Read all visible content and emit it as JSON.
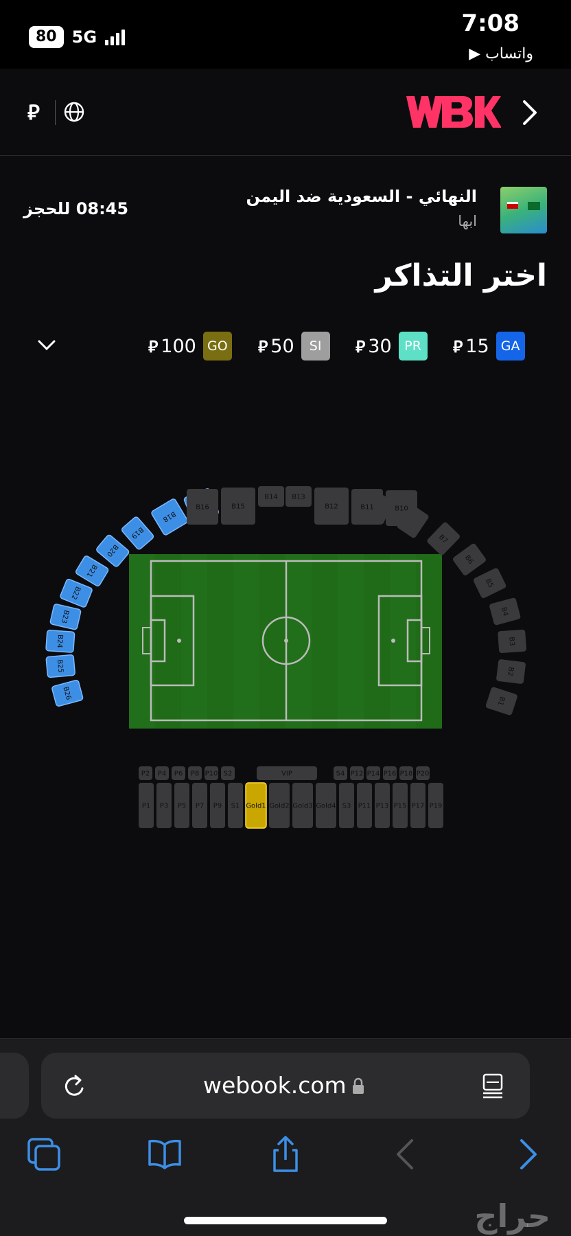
{
  "status_bar": {
    "battery": "80",
    "network": "5G",
    "time": "7:08",
    "back_app": "واتساب ▶"
  },
  "header": {
    "currency_symbol": "⃁",
    "logo_text": "WBK",
    "back_icon": "chevron-right-icon",
    "language_icon": "globe-icon"
  },
  "event": {
    "title": "النهائي - السعودية ضد اليمن",
    "city": "ابها",
    "timer_label": "08:45 للحجز"
  },
  "page_heading": "اختر التذاكر",
  "price_tiers": [
    {
      "code": "GA",
      "price": "15",
      "color": "#1565e8"
    },
    {
      "code": "PR",
      "price": "30",
      "color": "#5ee0c7"
    },
    {
      "code": "SI",
      "price": "50",
      "color": "#9e9e9e"
    },
    {
      "code": "GO",
      "price": "100",
      "color": "#7a6e12"
    }
  ],
  "currency_glyph": "⃁",
  "stadium": {
    "upper_left_selected": [
      "B17",
      "B18",
      "B19",
      "B20",
      "B21",
      "B22",
      "B23",
      "B24",
      "B25",
      "B26"
    ],
    "upper_top": [
      "B16",
      "B15",
      "B14",
      "B13",
      "B12",
      "B11",
      "B10"
    ],
    "upper_right": [
      "B9",
      "B8",
      "B7",
      "B6",
      "B5",
      "B4",
      "B3",
      "B2",
      "B1"
    ],
    "lower_top_row": [
      "P2",
      "P4",
      "P6",
      "P8",
      "P10",
      "S2",
      "VIP",
      "S4",
      "P12",
      "P14",
      "P16",
      "P18",
      "P20"
    ],
    "lower_bottom_row": [
      "P1",
      "P3",
      "P5",
      "P7",
      "P9",
      "S1",
      "Gold1",
      "Gold2",
      "Gold3",
      "Gold4",
      "S3",
      "P11",
      "P13",
      "P15",
      "P17",
      "P19"
    ],
    "selected_color": "#3d8fe6",
    "section_color": "#3a3a3c",
    "gold_color": "#c9a600",
    "field_color": "#1f6b17"
  },
  "browser": {
    "url": "webook.com",
    "reload_icon": "reload-icon",
    "lock_icon": "lock-icon",
    "reader_icon": "reader-icon",
    "toolbar": [
      "tabs-icon",
      "bookmarks-icon",
      "share-icon",
      "back-icon",
      "forward-icon"
    ]
  },
  "watermark": "حراج"
}
